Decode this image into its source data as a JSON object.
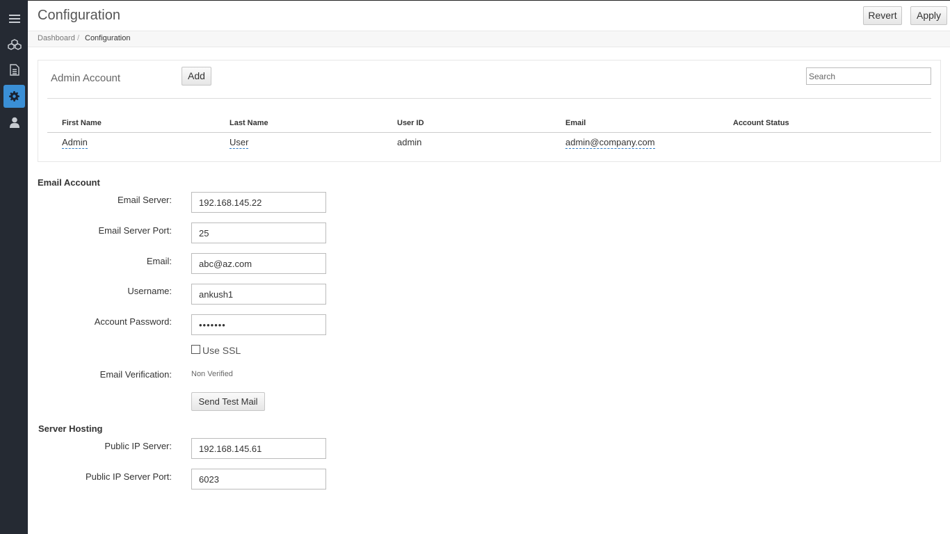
{
  "sidebar": {
    "items": [
      {
        "name": "menu",
        "icon": "hamburger-menu-icon"
      },
      {
        "name": "clusters",
        "icon": "cubes-icon"
      },
      {
        "name": "documents",
        "icon": "document-icon"
      },
      {
        "name": "configuration",
        "icon": "gear-icon",
        "active": true
      },
      {
        "name": "users",
        "icon": "user-icon"
      }
    ],
    "accent_color": "#3a8fd6",
    "bg_color": "#252a33"
  },
  "header": {
    "title": "Configuration",
    "revert_label": "Revert",
    "apply_label": "Apply"
  },
  "breadcrumb": {
    "parent": "Dashboard",
    "separator": "/",
    "current": "Configuration"
  },
  "admin_panel": {
    "title": "Admin Account",
    "add_label": "Add",
    "search_placeholder": "Search",
    "columns": [
      "First Name",
      "Last Name",
      "User ID",
      "Email",
      "Account Status"
    ],
    "rows": [
      {
        "first_name": "Admin",
        "last_name": "User",
        "user_id": "admin",
        "email": "admin@company.com",
        "status": ""
      }
    ]
  },
  "email_account": {
    "title": "Email Account",
    "server_label": "Email Server:",
    "server_value": "192.168.145.22",
    "port_label": "Email Server Port:",
    "port_value": "25",
    "email_label": "Email:",
    "email_value": "abc@az.com",
    "username_label": "Username:",
    "username_value": "ankush1",
    "password_label": "Account Password:",
    "password_value": "•••••••",
    "ssl_label": "Use SSL",
    "ssl_checked": false,
    "verification_label": "Email Verification:",
    "verification_status": "Non Verified",
    "send_test_label": "Send Test Mail"
  },
  "server_hosting": {
    "title": "Server Hosting",
    "public_ip_label": "Public IP Server:",
    "public_ip_value": "192.168.145.61",
    "public_port_label": "Public IP Server Port:",
    "public_port_value": "6023"
  }
}
